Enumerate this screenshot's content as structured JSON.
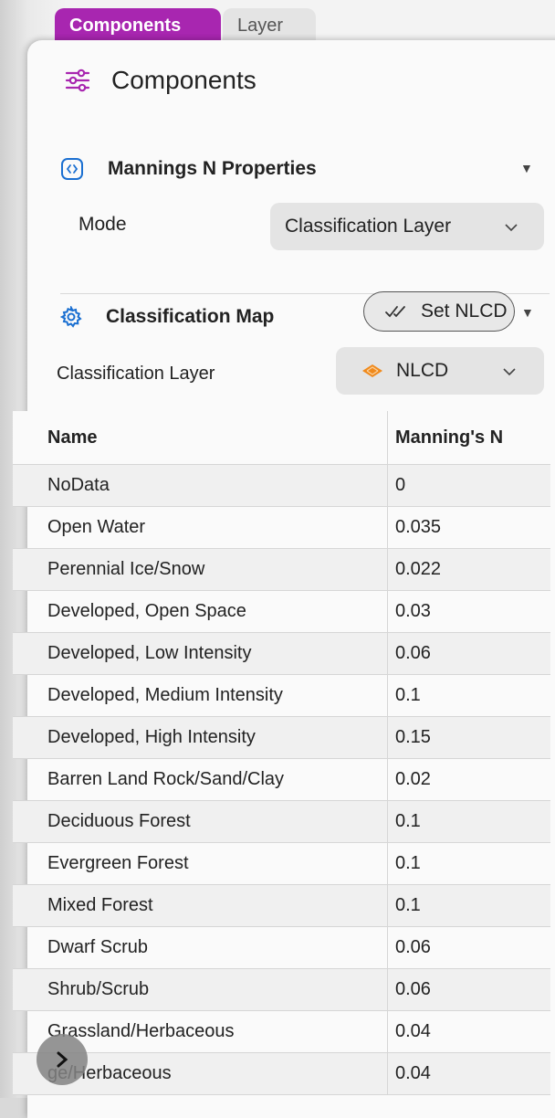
{
  "tabs": [
    {
      "label": "Components"
    },
    {
      "label": "Layer"
    }
  ],
  "header": {
    "title": "Components",
    "icon": "sliders-icon"
  },
  "mannings": {
    "title": "Mannings N Properties",
    "icon": "code-brackets-icon",
    "mode_label": "Mode",
    "mode_value": "Classification Layer"
  },
  "classification": {
    "title": "Classification Map",
    "icon": "gear-icon",
    "set_button": "Set NLCD",
    "layer_label": "Classification Layer",
    "layer_value": "NLCD",
    "layer_icon": "layers-diamond-icon"
  },
  "table": {
    "headers": [
      "Name",
      "Manning's N"
    ],
    "rows": [
      {
        "name": "NoData",
        "value": "0"
      },
      {
        "name": "Open Water",
        "value": "0.035"
      },
      {
        "name": "Perennial Ice/Snow",
        "value": "0.022"
      },
      {
        "name": "Developed, Open Space",
        "value": "0.03"
      },
      {
        "name": "Developed, Low Intensity",
        "value": "0.06"
      },
      {
        "name": "Developed, Medium Intensity",
        "value": "0.1"
      },
      {
        "name": "Developed, High Intensity",
        "value": "0.15"
      },
      {
        "name": "Barren Land Rock/Sand/Clay",
        "value": "0.02"
      },
      {
        "name": "Deciduous Forest",
        "value": "0.1"
      },
      {
        "name": "Evergreen Forest",
        "value": "0.1"
      },
      {
        "name": "Mixed Forest",
        "value": "0.1"
      },
      {
        "name": "Dwarf Scrub",
        "value": "0.06"
      },
      {
        "name": "Shrub/Scrub",
        "value": "0.06"
      },
      {
        "name": "Grassland/Herbaceous",
        "value": "0.04"
      },
      {
        "name": "ge/Herbaceous",
        "value": "0.04"
      }
    ]
  },
  "colors": {
    "accent": "#a826b0",
    "icon_blue": "#1a6fd1",
    "nlcd_orange": "#f08a1c"
  }
}
